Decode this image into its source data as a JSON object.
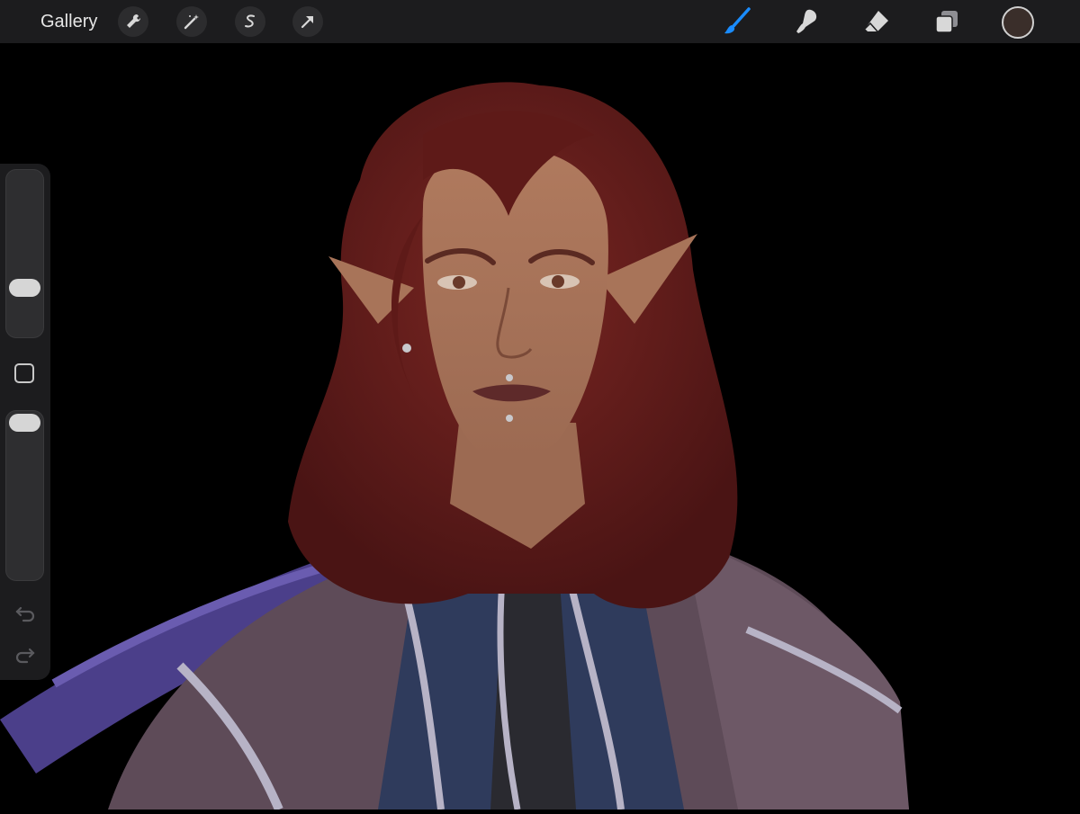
{
  "toolbar": {
    "gallery_label": "Gallery",
    "left_tools": [
      "wrench-icon",
      "magic-wand-icon",
      "selection-icon",
      "transform-arrow-icon"
    ],
    "right_tools": [
      "brush-icon",
      "smudge-icon",
      "eraser-icon",
      "layers-icon"
    ],
    "active_tool": "brush-icon",
    "active_color": "#3a2e2a",
    "accent_color": "#1a8cff"
  },
  "sidebar": {
    "brush_size_level": 0.27,
    "opacity_level": 1.0
  },
  "canvas": {
    "background": "#000000",
    "artwork": "portrait-illustration"
  }
}
